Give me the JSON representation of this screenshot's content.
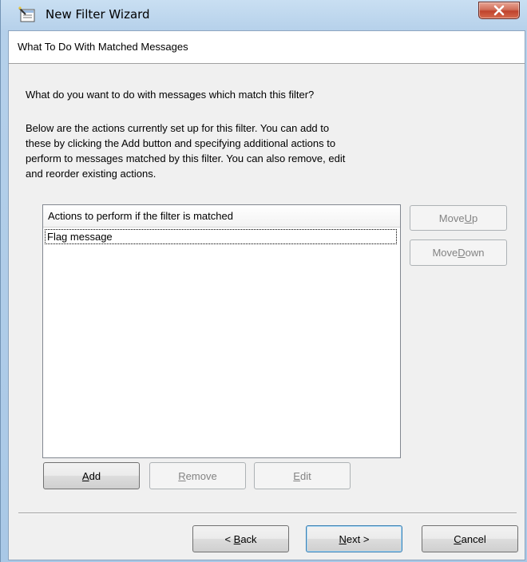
{
  "window": {
    "title": "New Filter Wizard"
  },
  "header": {
    "title": "What To Do With Matched Messages"
  },
  "body": {
    "question": "What do you want to do with messages which match this filter?",
    "description_lines": [
      "Below are the actions currently set up for this filter.  You can add to",
      "these by clicking the Add button and specifying additional actions to",
      "perform to messages matched by this filter.  You can also remove, edit",
      "and reorder existing actions."
    ]
  },
  "actions_list": {
    "header": "Actions to perform if the filter is matched",
    "items": [
      "Flag message"
    ]
  },
  "side_buttons": {
    "move_up": {
      "pre": "Move ",
      "key": "U",
      "post": "p"
    },
    "move_down": {
      "pre": "Move ",
      "key": "D",
      "post": "own"
    }
  },
  "list_buttons": {
    "add": {
      "pre": "",
      "key": "A",
      "post": "dd"
    },
    "remove": {
      "pre": "",
      "key": "R",
      "post": "emove"
    },
    "edit": {
      "pre": "",
      "key": "E",
      "post": "dit"
    }
  },
  "nav_buttons": {
    "back": {
      "pre": "< ",
      "key": "B",
      "post": "ack"
    },
    "next": {
      "pre": "",
      "key": "N",
      "post": "ext >"
    },
    "cancel": {
      "pre": "",
      "key": "C",
      "post": "ancel"
    }
  },
  "colors": {
    "window_frame": "#a9c8e6",
    "close_button": "#c0432c",
    "dialog_bg": "#f0f0f0"
  }
}
